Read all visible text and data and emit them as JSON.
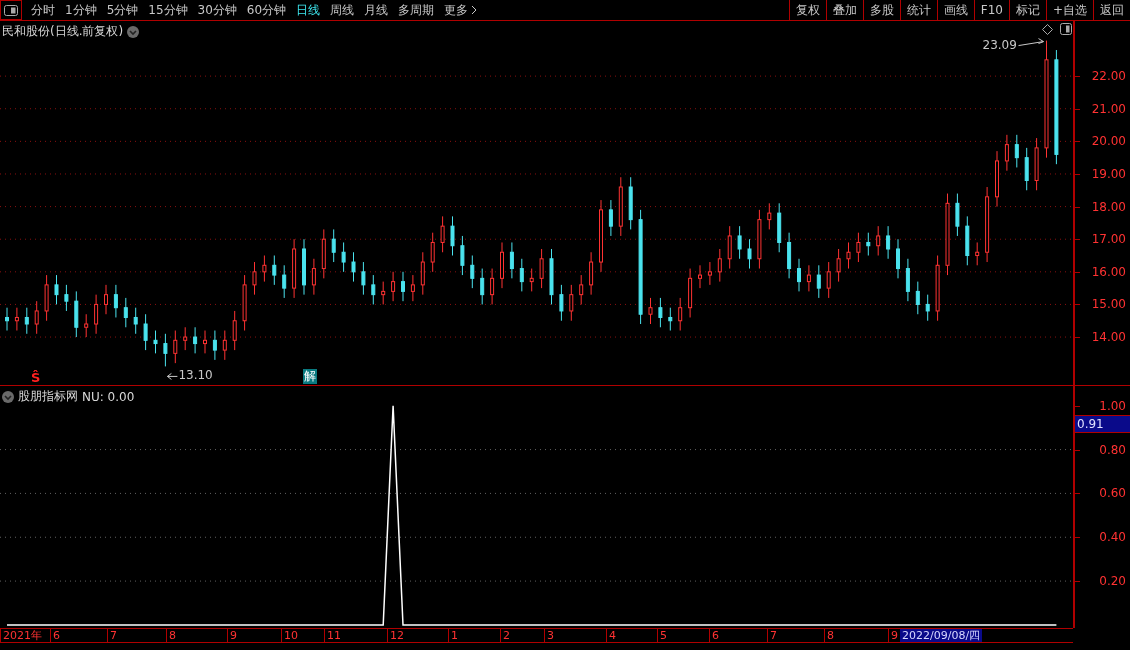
{
  "toolbar": {
    "tabs": [
      {
        "label": "分时",
        "selected": false
      },
      {
        "label": "1分钟",
        "selected": false
      },
      {
        "label": "5分钟",
        "selected": false
      },
      {
        "label": "15分钟",
        "selected": false
      },
      {
        "label": "30分钟",
        "selected": false
      },
      {
        "label": "60分钟",
        "selected": false
      },
      {
        "label": "日线",
        "selected": true
      },
      {
        "label": "周线",
        "selected": false
      },
      {
        "label": "月线",
        "selected": false
      },
      {
        "label": "多周期",
        "selected": false
      },
      {
        "label": "更多",
        "selected": false
      }
    ],
    "buttons": [
      "复权",
      "叠加",
      "多股",
      "统计",
      "画线",
      "F10",
      "标记",
      "+自选",
      "返回"
    ]
  },
  "price_panel": {
    "title": "民和股份(日线.前复权)",
    "high_label": "23.09",
    "low_label": "13.10",
    "markers": [
      {
        "kind": "signal",
        "text": "Ŝ"
      },
      {
        "kind": "event",
        "text": "解"
      }
    ],
    "chart_data": {
      "type": "candlestick",
      "ylim": [
        12.53,
        23.69
      ],
      "grid": true,
      "yticks": [
        {
          "value": 14,
          "label": "14.00"
        },
        {
          "value": 15,
          "label": "15.00"
        },
        {
          "value": 16,
          "label": "16.00"
        },
        {
          "value": 17,
          "label": "17.00"
        },
        {
          "value": 18,
          "label": "18.00"
        },
        {
          "value": 19,
          "label": "19.00"
        },
        {
          "value": 20,
          "label": "20.00"
        },
        {
          "value": 21,
          "label": "21.00"
        },
        {
          "value": 22,
          "label": "22.00"
        }
      ],
      "ohlc": [
        [
          14.6,
          14.9,
          14.2,
          14.5
        ],
        [
          14.5,
          14.9,
          14.2,
          14.6
        ],
        [
          14.6,
          14.9,
          14.1,
          14.4
        ],
        [
          14.4,
          15.1,
          14.1,
          14.8
        ],
        [
          14.8,
          15.9,
          14.5,
          15.6
        ],
        [
          15.6,
          15.9,
          15.0,
          15.3
        ],
        [
          15.3,
          15.6,
          14.8,
          15.1
        ],
        [
          15.1,
          15.4,
          14.0,
          14.3
        ],
        [
          14.3,
          14.7,
          14.0,
          14.4
        ],
        [
          14.4,
          15.3,
          14.1,
          15.0
        ],
        [
          15.0,
          15.6,
          14.7,
          15.3
        ],
        [
          15.3,
          15.6,
          14.6,
          14.9
        ],
        [
          14.9,
          15.2,
          14.3,
          14.6
        ],
        [
          14.6,
          14.9,
          14.1,
          14.4
        ],
        [
          14.4,
          14.7,
          13.6,
          13.9
        ],
        [
          13.9,
          14.2,
          13.5,
          13.8
        ],
        [
          13.8,
          14.1,
          13.1,
          13.5
        ],
        [
          13.5,
          14.2,
          13.2,
          13.9
        ],
        [
          13.9,
          14.3,
          13.6,
          14.0
        ],
        [
          14.0,
          14.3,
          13.5,
          13.8
        ],
        [
          13.8,
          14.2,
          13.5,
          13.9
        ],
        [
          13.9,
          14.2,
          13.3,
          13.6
        ],
        [
          13.6,
          14.2,
          13.3,
          13.9
        ],
        [
          13.9,
          14.8,
          13.6,
          14.5
        ],
        [
          14.5,
          15.9,
          14.2,
          15.6
        ],
        [
          15.6,
          16.3,
          15.3,
          16.0
        ],
        [
          16.0,
          16.5,
          15.7,
          16.2
        ],
        [
          16.2,
          16.5,
          15.6,
          15.9
        ],
        [
          15.9,
          16.2,
          15.2,
          15.5
        ],
        [
          15.5,
          17.0,
          15.2,
          16.7
        ],
        [
          16.7,
          17.0,
          15.3,
          15.6
        ],
        [
          15.6,
          16.4,
          15.3,
          16.1
        ],
        [
          16.1,
          17.3,
          15.8,
          17.0
        ],
        [
          17.0,
          17.3,
          16.3,
          16.6
        ],
        [
          16.6,
          16.9,
          16.0,
          16.3
        ],
        [
          16.3,
          16.6,
          15.7,
          16.0
        ],
        [
          16.0,
          16.3,
          15.3,
          15.6
        ],
        [
          15.6,
          15.9,
          15.0,
          15.3
        ],
        [
          15.3,
          15.7,
          15.0,
          15.4
        ],
        [
          15.4,
          16.0,
          15.1,
          15.7
        ],
        [
          15.7,
          16.0,
          15.1,
          15.4
        ],
        [
          15.4,
          15.9,
          15.1,
          15.6
        ],
        [
          15.6,
          16.6,
          15.3,
          16.3
        ],
        [
          16.3,
          17.2,
          16.0,
          16.9
        ],
        [
          16.9,
          17.7,
          16.6,
          17.4
        ],
        [
          17.4,
          17.7,
          16.5,
          16.8
        ],
        [
          16.8,
          17.1,
          15.9,
          16.2
        ],
        [
          16.2,
          16.5,
          15.5,
          15.8
        ],
        [
          15.8,
          16.1,
          15.0,
          15.3
        ],
        [
          15.3,
          16.1,
          15.0,
          15.8
        ],
        [
          15.8,
          16.9,
          15.5,
          16.6
        ],
        [
          16.6,
          16.9,
          15.8,
          16.1
        ],
        [
          16.1,
          16.4,
          15.4,
          15.7
        ],
        [
          15.7,
          16.1,
          15.4,
          15.8
        ],
        [
          15.8,
          16.7,
          15.5,
          16.4
        ],
        [
          16.4,
          16.7,
          15.0,
          15.3
        ],
        [
          15.3,
          15.6,
          14.5,
          14.8
        ],
        [
          14.8,
          15.6,
          14.5,
          15.3
        ],
        [
          15.3,
          15.9,
          15.0,
          15.6
        ],
        [
          15.6,
          16.6,
          15.3,
          16.3
        ],
        [
          16.3,
          18.2,
          16.0,
          17.9
        ],
        [
          17.9,
          18.2,
          17.1,
          17.4
        ],
        [
          17.4,
          18.9,
          17.1,
          18.6
        ],
        [
          18.6,
          18.9,
          17.3,
          17.6
        ],
        [
          17.6,
          17.9,
          14.4,
          14.7
        ],
        [
          14.7,
          15.2,
          14.4,
          14.9
        ],
        [
          14.9,
          15.2,
          14.3,
          14.6
        ],
        [
          14.6,
          14.9,
          14.2,
          14.5
        ],
        [
          14.5,
          15.2,
          14.2,
          14.9
        ],
        [
          14.9,
          16.1,
          14.6,
          15.8
        ],
        [
          15.8,
          16.2,
          15.5,
          15.9
        ],
        [
          15.9,
          16.3,
          15.6,
          16.0
        ],
        [
          16.0,
          16.7,
          15.7,
          16.4
        ],
        [
          16.4,
          17.4,
          16.1,
          17.1
        ],
        [
          17.1,
          17.4,
          16.4,
          16.7
        ],
        [
          16.7,
          17.0,
          16.1,
          16.4
        ],
        [
          16.4,
          17.9,
          16.1,
          17.6
        ],
        [
          17.6,
          18.1,
          17.3,
          17.8
        ],
        [
          17.8,
          18.1,
          16.6,
          16.9
        ],
        [
          16.9,
          17.2,
          15.8,
          16.1
        ],
        [
          16.1,
          16.4,
          15.4,
          15.7
        ],
        [
          15.7,
          16.2,
          15.4,
          15.9
        ],
        [
          15.9,
          16.2,
          15.2,
          15.5
        ],
        [
          15.5,
          16.3,
          15.2,
          16.0
        ],
        [
          16.0,
          16.7,
          15.7,
          16.4
        ],
        [
          16.4,
          16.9,
          16.1,
          16.6
        ],
        [
          16.6,
          17.2,
          16.3,
          16.9
        ],
        [
          16.9,
          17.2,
          16.5,
          16.8
        ],
        [
          16.8,
          17.4,
          16.5,
          17.1
        ],
        [
          17.1,
          17.4,
          16.4,
          16.7
        ],
        [
          16.7,
          17.0,
          15.8,
          16.1
        ],
        [
          16.1,
          16.4,
          15.1,
          15.4
        ],
        [
          15.4,
          15.7,
          14.7,
          15.0
        ],
        [
          15.0,
          15.3,
          14.5,
          14.8
        ],
        [
          14.8,
          16.5,
          14.5,
          16.2
        ],
        [
          16.2,
          18.4,
          15.9,
          18.1
        ],
        [
          18.1,
          18.4,
          17.1,
          17.4
        ],
        [
          17.4,
          17.7,
          16.2,
          16.5
        ],
        [
          16.5,
          16.9,
          16.2,
          16.6
        ],
        [
          16.6,
          18.6,
          16.3,
          18.3
        ],
        [
          18.3,
          19.7,
          18.0,
          19.4
        ],
        [
          19.4,
          20.2,
          19.1,
          19.9
        ],
        [
          19.9,
          20.2,
          19.2,
          19.5
        ],
        [
          19.5,
          19.8,
          18.5,
          18.8
        ],
        [
          18.8,
          20.1,
          18.5,
          19.8
        ],
        [
          19.8,
          23.09,
          19.5,
          22.5
        ],
        [
          22.5,
          22.8,
          19.3,
          19.6
        ]
      ]
    }
  },
  "indicator_panel": {
    "label": "股朋指标网",
    "reading": "NU: 0.00",
    "current": "0.91",
    "chart_data": {
      "type": "line",
      "ylim": [
        -0.014,
        1.09
      ],
      "grid": true,
      "yticks": [
        {
          "value": 0.2,
          "label": "0.20"
        },
        {
          "value": 0.4,
          "label": "0.40"
        },
        {
          "value": 0.6,
          "label": "0.60"
        },
        {
          "value": 0.8,
          "label": "0.80"
        },
        {
          "value": 1.0,
          "label": "1.00"
        }
      ],
      "series": [
        {
          "color": "#ffffff",
          "values": [
            0,
            0,
            0,
            0,
            0,
            0,
            0,
            0,
            0,
            0,
            0,
            0,
            0,
            0,
            0,
            0,
            0,
            0,
            0,
            0,
            0,
            0,
            0,
            0,
            0,
            0,
            0,
            0,
            0,
            0,
            0,
            0,
            0,
            0,
            0,
            0,
            0,
            0,
            0,
            1.0,
            0,
            0,
            0,
            0,
            0,
            0,
            0,
            0,
            0,
            0,
            0,
            0,
            0,
            0,
            0,
            0,
            0,
            0,
            0,
            0,
            0,
            0,
            0,
            0,
            0,
            0,
            0,
            0,
            0,
            0,
            0,
            0,
            0,
            0,
            0,
            0,
            0,
            0,
            0,
            0,
            0,
            0,
            0,
            0,
            0,
            0,
            0,
            0,
            0,
            0,
            0,
            0,
            0,
            0,
            0,
            0,
            0,
            0,
            0,
            0,
            0,
            0,
            0,
            0,
            0,
            0,
            0
          ]
        }
      ]
    }
  },
  "x_axis": {
    "labels": [
      "2021年",
      "6",
      "7",
      "8",
      "9",
      "10",
      "11",
      "12",
      "1",
      "2",
      "3",
      "4",
      "5",
      "6",
      "7",
      "8",
      "9"
    ],
    "date": "2022/09/08/四"
  }
}
